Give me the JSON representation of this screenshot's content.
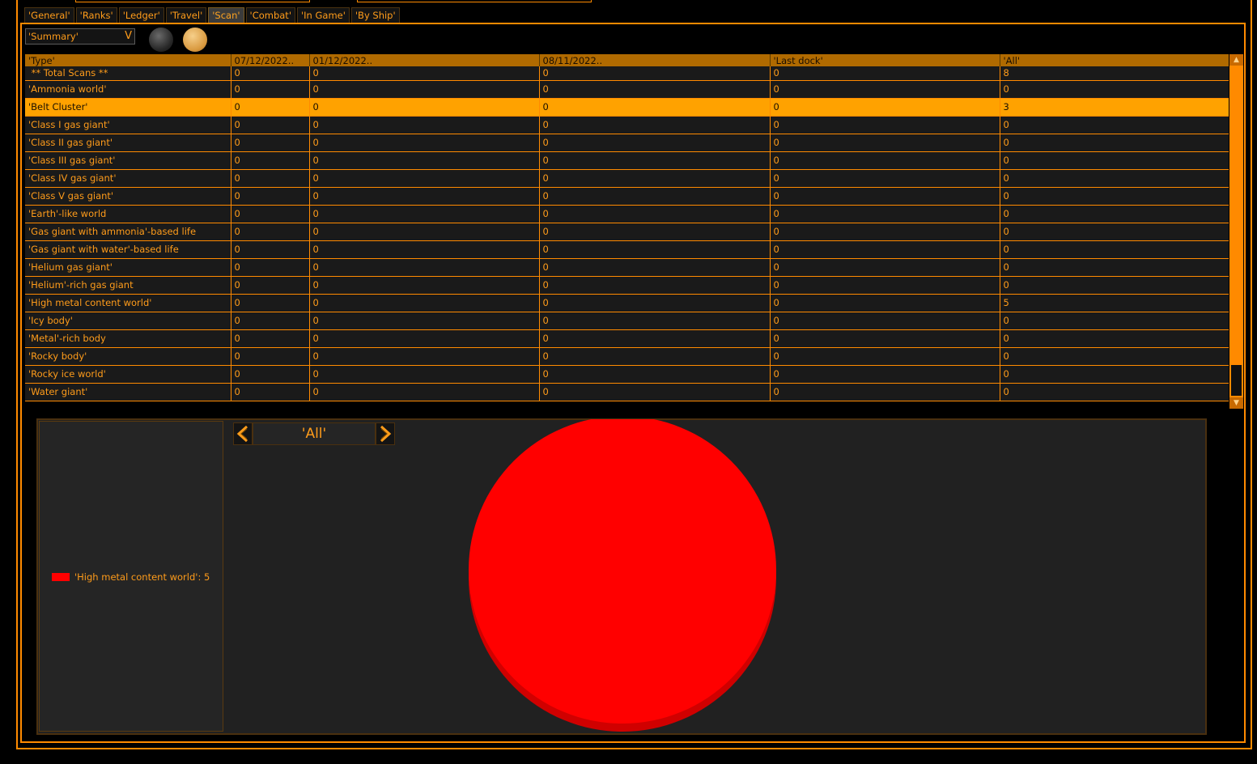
{
  "tabs": [
    {
      "label": "'General'",
      "active": false
    },
    {
      "label": "'Ranks'",
      "active": false
    },
    {
      "label": "'Ledger'",
      "active": false
    },
    {
      "label": "'Travel'",
      "active": false
    },
    {
      "label": "'Scan'",
      "active": true
    },
    {
      "label": "'Combat'",
      "active": false
    },
    {
      "label": "'In Game'",
      "active": false
    },
    {
      "label": "'By Ship'",
      "active": false
    }
  ],
  "filter": {
    "selected": "'Summary'",
    "arrow": "V"
  },
  "table": {
    "columns": [
      "'Type'",
      "07/12/2022..",
      "01/12/2022..",
      "08/11/2022..",
      "'Last dock'",
      "'All'"
    ],
    "rows": [
      [
        "** Total Scans **",
        "0",
        "0",
        "0",
        "0",
        "8"
      ],
      [
        "'Ammonia world'",
        "0",
        "0",
        "0",
        "0",
        "0"
      ],
      [
        "'Belt Cluster'",
        "0",
        "0",
        "0",
        "0",
        "3"
      ],
      [
        "'Class I gas giant'",
        "0",
        "0",
        "0",
        "0",
        "0"
      ],
      [
        "'Class II gas giant'",
        "0",
        "0",
        "0",
        "0",
        "0"
      ],
      [
        "'Class III gas giant'",
        "0",
        "0",
        "0",
        "0",
        "0"
      ],
      [
        "'Class IV gas giant'",
        "0",
        "0",
        "0",
        "0",
        "0"
      ],
      [
        "'Class V gas giant'",
        "0",
        "0",
        "0",
        "0",
        "0"
      ],
      [
        "'Earth'-like world",
        "0",
        "0",
        "0",
        "0",
        "0"
      ],
      [
        "'Gas giant with ammonia'-based life",
        "0",
        "0",
        "0",
        "0",
        "0"
      ],
      [
        "'Gas giant with water'-based life",
        "0",
        "0",
        "0",
        "0",
        "0"
      ],
      [
        "'Helium gas giant'",
        "0",
        "0",
        "0",
        "0",
        "0"
      ],
      [
        "'Helium'-rich gas giant",
        "0",
        "0",
        "0",
        "0",
        "0"
      ],
      [
        "'High metal content world'",
        "0",
        "0",
        "0",
        "0",
        "5"
      ],
      [
        "'Icy body'",
        "0",
        "0",
        "0",
        "0",
        "0"
      ],
      [
        "'Metal'-rich body",
        "0",
        "0",
        "0",
        "0",
        "0"
      ],
      [
        "'Rocky body'",
        "0",
        "0",
        "0",
        "0",
        "0"
      ],
      [
        "'Rocky ice world'",
        "0",
        "0",
        "0",
        "0",
        "0"
      ],
      [
        "'Water giant'",
        "0",
        "0",
        "0",
        "0",
        "0"
      ]
    ],
    "selected_row": 2
  },
  "scrollbar": {
    "up_glyph": "▲",
    "down_glyph": "▼"
  },
  "chart": {
    "selector_label": "'All'",
    "legend": [
      {
        "label": "'High metal content world': 5",
        "color": "#ff0000"
      }
    ]
  },
  "chart_data": {
    "type": "pie",
    "slices": [
      {
        "label": "'High metal content world'",
        "value": 5,
        "color": "#ff0000"
      }
    ]
  }
}
